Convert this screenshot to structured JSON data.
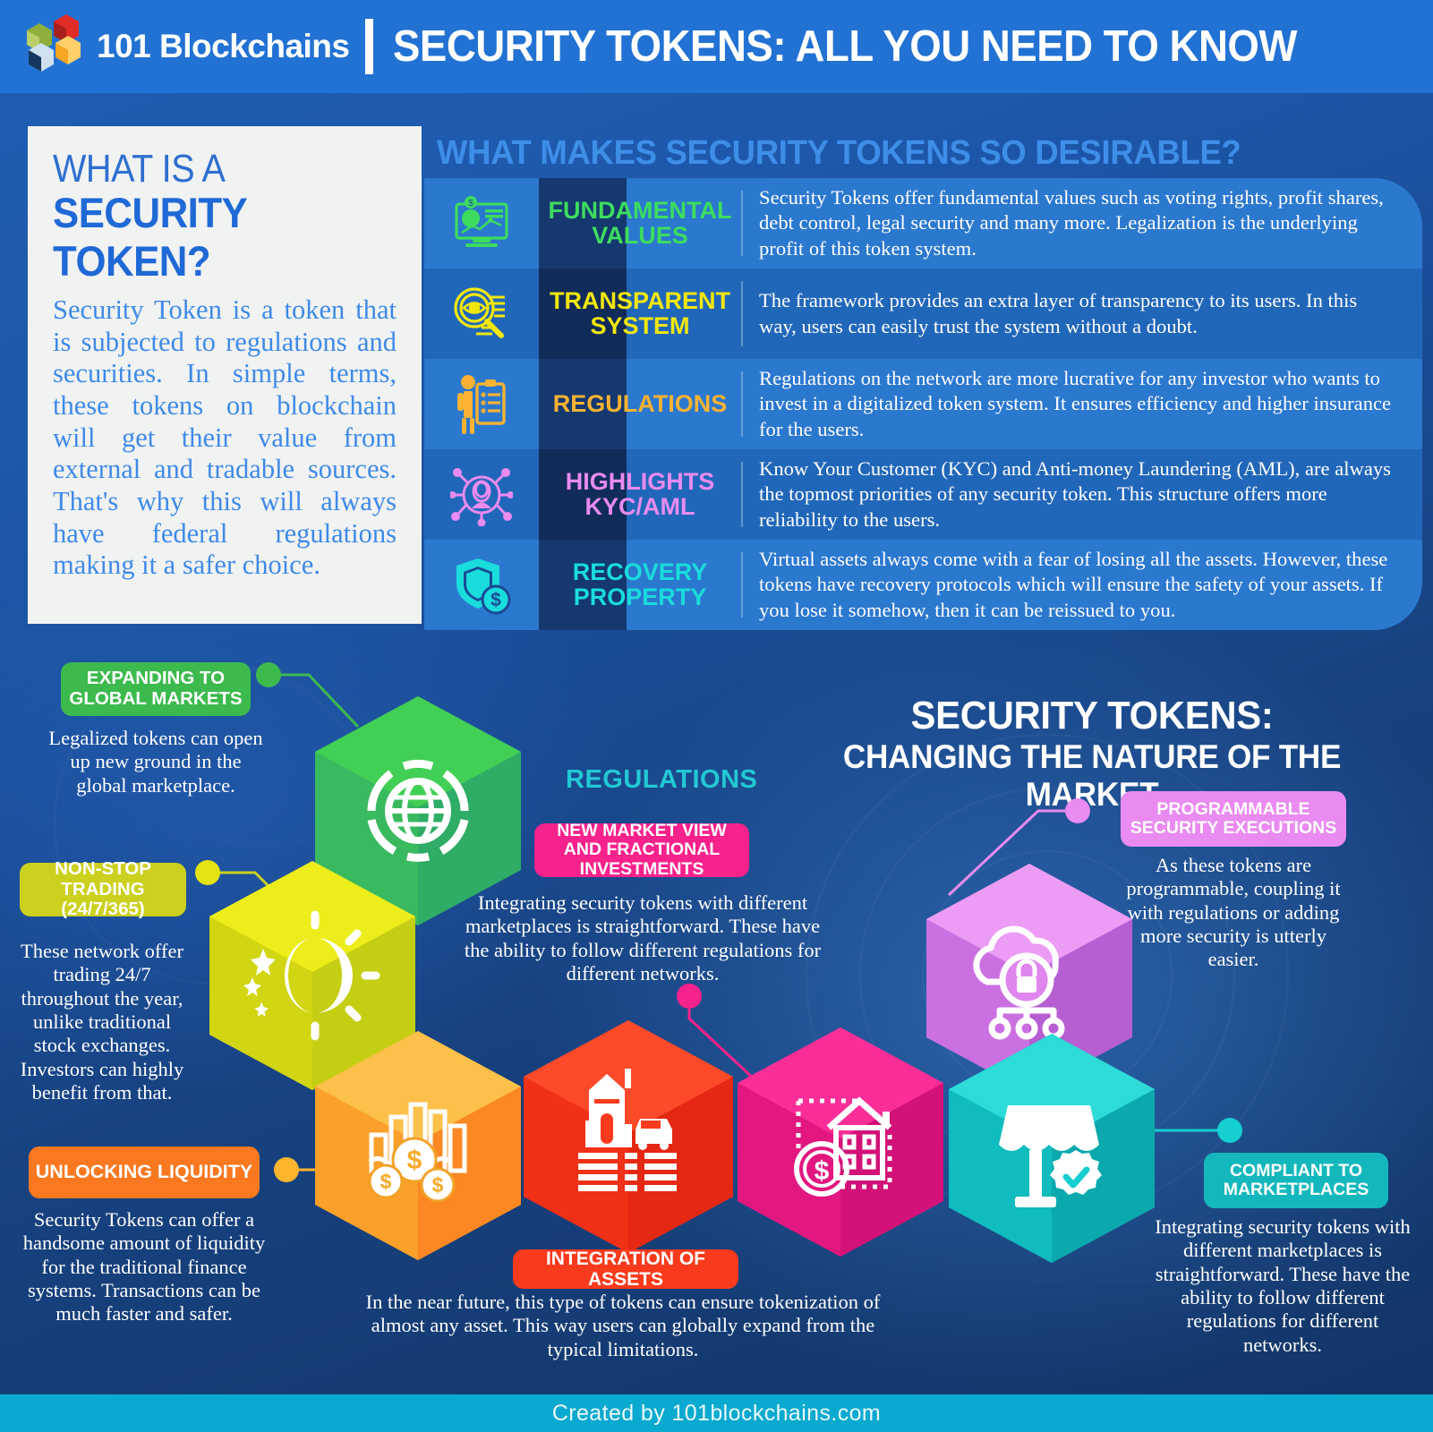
{
  "header": {
    "brand": "101 Blockchains",
    "headline": "SECURITY TOKENS: ALL YOU NEED TO KNOW",
    "logo_icon": "blockchain-cubes-logo"
  },
  "what_is": {
    "title_line1": "WHAT IS A",
    "title_line2": "SECURITY TOKEN?",
    "body": "Security Token is a token that is subjected to regulations and securities. In simple terms, these tokens on blockchain will get their value from external and tradable sources. That's why this will always have federal regulations making it a safer choice."
  },
  "desirable": {
    "title": "WHAT MAKES SECURITY TOKENS SO DESIRABLE?",
    "rows": [
      {
        "icon": "monitor-chart-dollar-icon",
        "title": "FUNDAMENTAL VALUES",
        "color": "#3ddc5e",
        "desc": "Security Tokens offer fundamental values such as voting rights, profit shares, debt control, legal security and many more. Legalization is the underlying profit of this token system."
      },
      {
        "icon": "magnifier-eye-icon",
        "title": "TRANSPARENT SYSTEM",
        "color": "#f2e70c",
        "desc": "The framework provides an extra layer of transparency to its users. In this way, users can easily trust the system without a doubt."
      },
      {
        "icon": "person-clipboard-icon",
        "title": "REGULATIONS",
        "color": "#f9b233",
        "desc": "Regulations on the network are more lucrative for any investor who wants to invest in a digitalized token system. It ensures efficiency and higher insurance for the users."
      },
      {
        "icon": "user-network-icon",
        "title": "HIGHLIGHTS KYC/AML",
        "color": "#e98bf0",
        "desc": "Know Your Customer (KYC) and Anti-money Laundering (AML), are always the topmost priorities of any security token. This structure offers more reliability to the users."
      },
      {
        "icon": "shield-dollar-icon",
        "title": "RECOVERY PROPERTY",
        "color": "#19dcdc",
        "desc": "Virtual assets always come with a fear of losing all the assets. However, these tokens have recovery protocols which will ensure the safety of your assets. If you lose it somehow, then it can be reissued to you."
      }
    ]
  },
  "market": {
    "title_line1": "SECURITY TOKENS:",
    "title_line2": "CHANGING THE NATURE OF THE MARKET",
    "regulations_label": "REGULATIONS",
    "cards": [
      {
        "id": "expanding-global-markets",
        "pill": "EXPANDING TO GLOBAL MARKETS",
        "pill_color": "#3dba4e",
        "blurb": "Legalized tokens can open up new ground in the global marketplace.",
        "hex_icon": "globe-target-icon",
        "hex_color": "#3dc04f"
      },
      {
        "id": "non-stop-trading",
        "pill": "NON-STOP TRADING (24/7/365)",
        "pill_color": "#ccd01e",
        "blurb": "These network offer trading 24/7 throughout the year, unlike traditional stock exchanges. Investors can highly benefit from that.",
        "hex_icon": "sun-moon-icon",
        "hex_color": "#e4e312"
      },
      {
        "id": "unlocking-liquidity",
        "pill": "UNLOCKING LIQUIDITY",
        "pill_color": "#f97820",
        "blurb": "Security Tokens can offer a handsome amount of liquidity for the traditional finance systems. Transactions can be much faster and safer.",
        "hex_icon": "bar-chart-coins-icon",
        "hex_color": "#fcb52c"
      },
      {
        "id": "new-market-view",
        "pill": "NEW MARKET VIEW AND FRACTIONAL INVESTMENTS",
        "pill_color": "#f8228c",
        "blurb": "Integrating security tokens with different marketplaces is straightforward. These have the ability to follow different regulations for different networks.",
        "hex_icon": "house-coin-icon",
        "hex_color": "#f61e8b"
      },
      {
        "id": "integration-of-assets",
        "pill": "INTEGRATION OF ASSETS",
        "pill_color": "#fa3a1c",
        "blurb": "In the near future, this type of tokens can ensure tokenization of almost any asset. This way users can globally expand from the typical limitations.",
        "hex_icon": "city-car-icon",
        "hex_color": "#fb3b1d"
      },
      {
        "id": "programmable-security-executions",
        "pill": "PROGRAMMABLE SECURITY EXECUTIONS",
        "pill_color": "#e98bf0",
        "blurb": "As these tokens are programmable, coupling it with regulations or adding more security is utterly easier.",
        "hex_icon": "cloud-lock-network-icon",
        "hex_color": "#df86ee"
      },
      {
        "id": "compliant-to-marketplaces",
        "pill": "COMPLIANT TO MARKETPLACES",
        "pill_color": "#14b8bc",
        "blurb": "Integrating security tokens with different marketplaces is straightforward. These have the ability to follow different regulations for different networks.",
        "hex_icon": "shop-verified-icon",
        "hex_color": "#16cfd0"
      }
    ]
  },
  "footer": {
    "credit": "Created by 101blockchains.com"
  },
  "colors": {
    "header_bg": "#2272d4",
    "page_bg": "#1b4b9c",
    "footer_bg": "#0aa9cf",
    "panel_bg": "#f1f2f2",
    "accent_blue": "#3e8ae8"
  }
}
